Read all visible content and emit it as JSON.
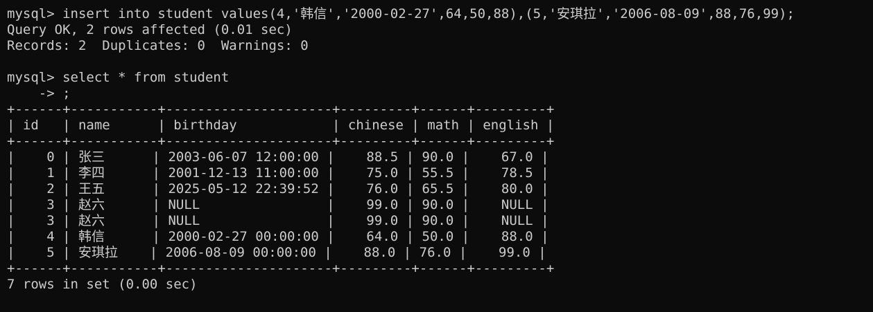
{
  "colors": {
    "background": "#0c0c0c",
    "foreground": "#cccccc"
  },
  "lines": [
    "mysql> insert into student values(4,'韩信','2000-02-27',64,50,88),(5,'安琪拉','2006-08-09',88,76,99);",
    "Query OK, 2 rows affected (0.01 sec)",
    "Records: 2  Duplicates: 0  Warnings: 0",
    "",
    "mysql> select * from student",
    "    -> ;",
    "+------+-----------+---------------------+---------+------+---------+",
    "| id   | name      | birthday            | chinese | math | english |",
    "+------+-----------+---------------------+---------+------+---------+",
    "|    0 | 张三      | 2003-06-07 12:00:00 |    88.5 | 90.0 |    67.0 |",
    "|    1 | 李四      | 2001-12-13 11:00:00 |    75.0 | 55.5 |    78.5 |",
    "|    2 | 王五      | 2025-05-12 22:39:52 |    76.0 | 65.5 |    80.0 |",
    "|    3 | 赵六      | NULL                |    99.0 | 90.0 |    NULL |",
    "|    3 | 赵六      | NULL                |    99.0 | 90.0 |    NULL |",
    "|    4 | 韩信      | 2000-02-27 00:00:00 |    64.0 | 50.0 |    88.0 |",
    "|    5 | 安琪拉    | 2006-08-09 00:00:00 |    88.0 | 76.0 |    99.0 |",
    "+------+-----------+---------------------+---------+------+---------+",
    "7 rows in set (0.00 sec)"
  ]
}
